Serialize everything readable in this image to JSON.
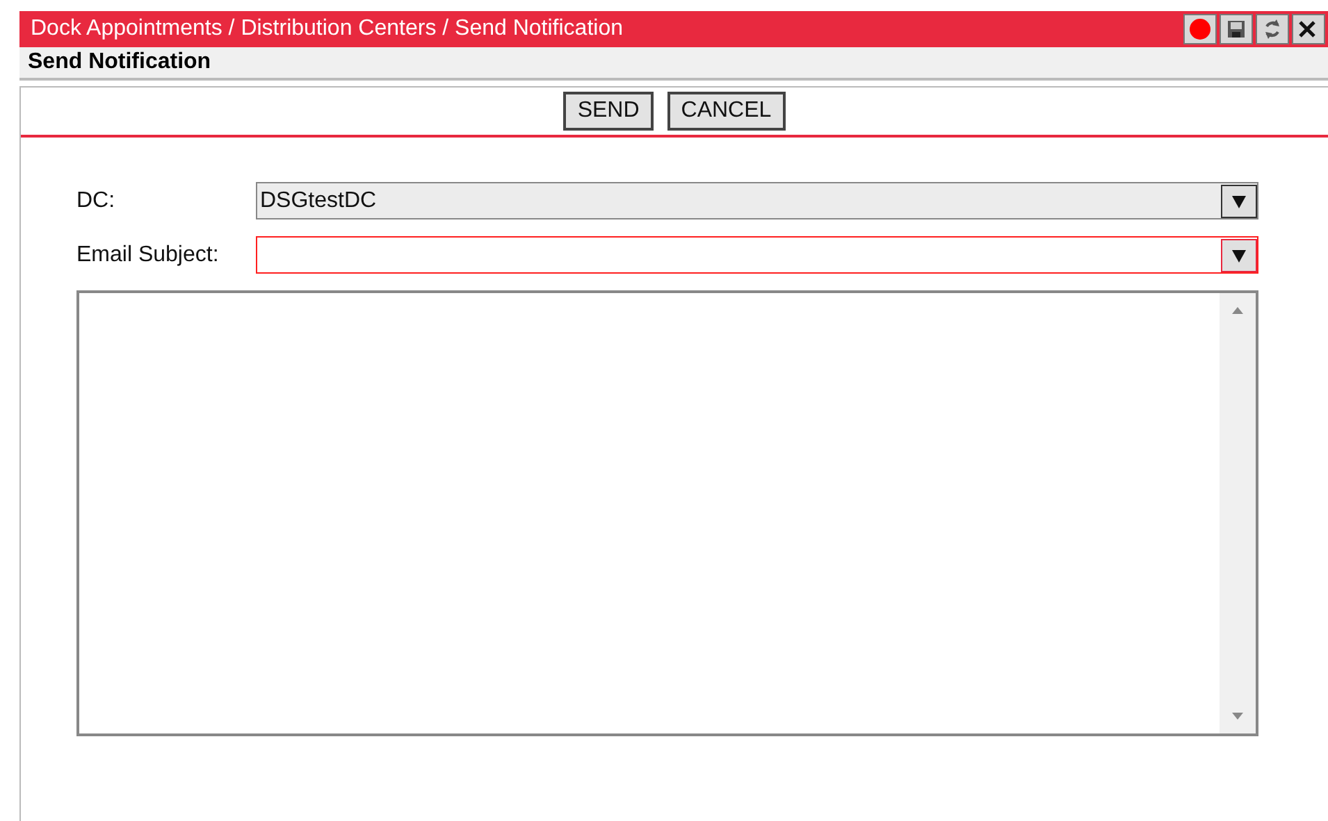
{
  "window": {
    "title": "Dock Appointments / Distribution Centers / Send Notification"
  },
  "subheader": "Send Notification",
  "toolbar": {
    "buttons": [
      "SEND",
      "CANCEL"
    ]
  },
  "form": {
    "fields": [
      {
        "label": "DC:",
        "value": "DSGtestDC",
        "invalid": false
      },
      {
        "label": "Email Subject:",
        "invalid": true
      }
    ]
  }
}
